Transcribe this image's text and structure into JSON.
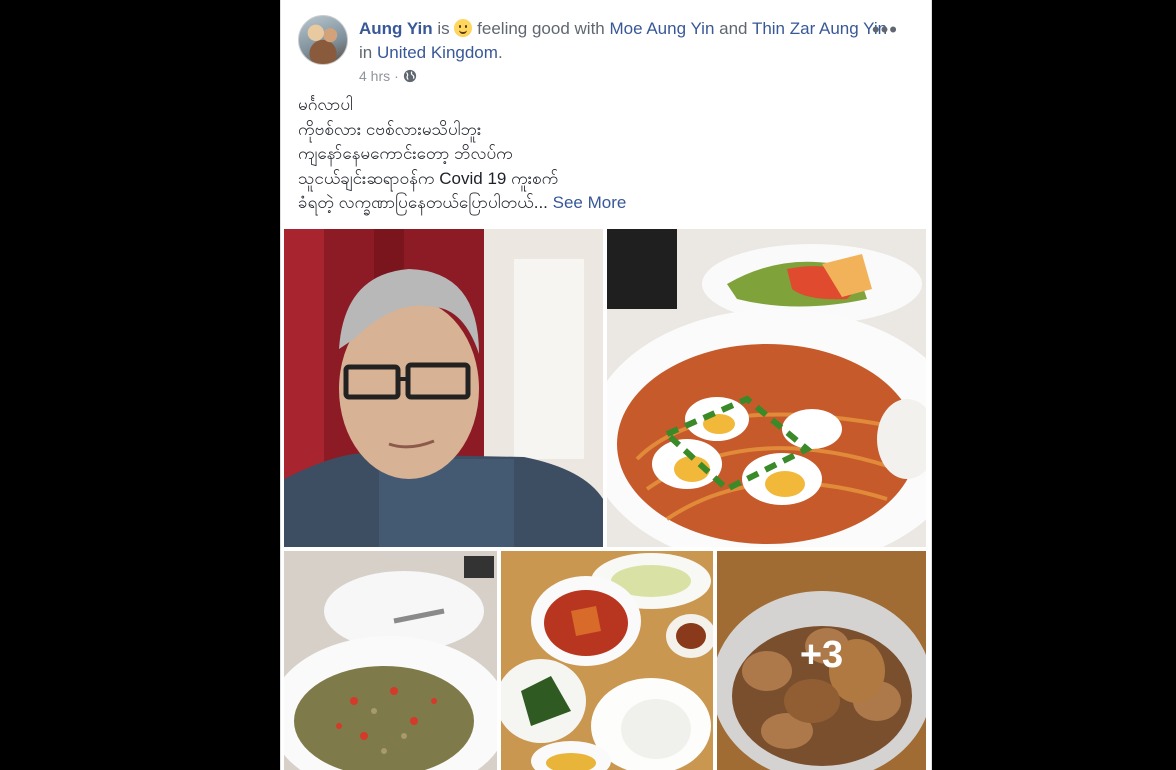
{
  "post": {
    "author": "Aung Yin",
    "verb": "is",
    "feeling": "feeling good with",
    "with_1": "Moe Aung Yin",
    "and_word": "and",
    "with_2": "Thin Zar Aung Yin",
    "in_word": "in",
    "location": "United Kingdom",
    "period": ".",
    "time": "4 hrs",
    "dot": "·",
    "lines": [
      "မင်္ဂလာပါ",
      "ကိုဗစ်လား ငဗစ်လားမသိပါဘူး",
      "ကျနော်နေမကောင်းတော့ ဘိလပ်က",
      "သူငယ်ချင်းဆရာဝန်က Covid 19 ကူးစက်",
      "ခံရတဲ့ လက္ခဏာပြနေတယ်ပြောပါတယ်..."
    ],
    "see_more": "See More",
    "more_photos": "+3"
  },
  "colors": {
    "link": "#385898",
    "meta": "#90949c"
  },
  "icons": [
    "smile-emoji-icon",
    "globe-icon",
    "more-options-icon"
  ]
}
